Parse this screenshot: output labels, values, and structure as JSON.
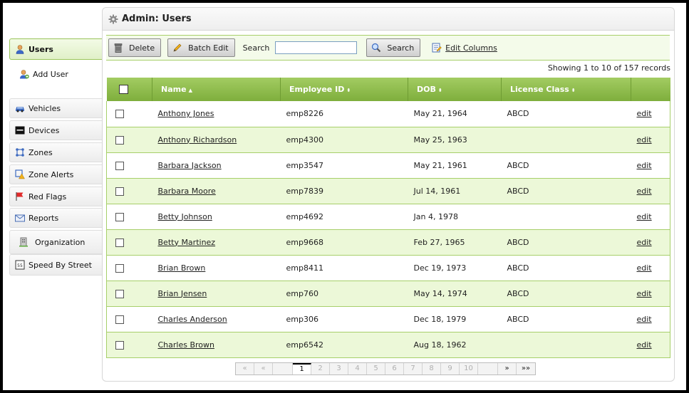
{
  "header": {
    "title": "Admin: Users"
  },
  "sidebar": {
    "items": [
      {
        "label": "Users",
        "icon": "user-icon"
      },
      {
        "label": "Add User",
        "icon": "add-user-icon"
      },
      {
        "label": "Vehicles",
        "icon": "car-icon"
      },
      {
        "label": "Devices",
        "icon": "device-icon"
      },
      {
        "label": "Zones",
        "icon": "zones-icon"
      },
      {
        "label": "Zone Alerts",
        "icon": "zone-alert-icon"
      },
      {
        "label": "Red Flags",
        "icon": "red-flag-icon"
      },
      {
        "label": "Reports",
        "icon": "envelope-icon"
      },
      {
        "label": "Organization",
        "icon": "organization-icon"
      },
      {
        "label": "Speed By Street",
        "icon": "speed-sign-icon"
      }
    ]
  },
  "toolbar": {
    "delete_label": "Delete",
    "batch_edit_label": "Batch Edit",
    "search_label": "Search",
    "search_value": "",
    "search_button_label": "Search",
    "edit_columns_label": "Edit Columns"
  },
  "status": {
    "showing": "Showing 1 to 10 of 157 records"
  },
  "table": {
    "columns": [
      "Name",
      "Employee ID",
      "DOB",
      "License Class"
    ],
    "rows": [
      {
        "name": "Anthony Jones",
        "employee_id": "emp8226",
        "dob": "May 21, 1964",
        "license": "ABCD",
        "edit": "edit"
      },
      {
        "name": "Anthony Richardson",
        "employee_id": "emp4300",
        "dob": "May 25, 1963",
        "license": "",
        "edit": "edit"
      },
      {
        "name": "Barbara Jackson",
        "employee_id": "emp3547",
        "dob": "May 21, 1961",
        "license": "ABCD",
        "edit": "edit"
      },
      {
        "name": "Barbara Moore",
        "employee_id": "emp7839",
        "dob": "Jul 14, 1961",
        "license": "ABCD",
        "edit": "edit"
      },
      {
        "name": "Betty Johnson",
        "employee_id": "emp4692",
        "dob": "Jan 4, 1978",
        "license": "",
        "edit": "edit"
      },
      {
        "name": "Betty Martinez",
        "employee_id": "emp9668",
        "dob": "Feb 27, 1965",
        "license": "ABCD",
        "edit": "edit"
      },
      {
        "name": "Brian Brown",
        "employee_id": "emp8411",
        "dob": "Dec 19, 1973",
        "license": "ABCD",
        "edit": "edit"
      },
      {
        "name": "Brian Jensen",
        "employee_id": "emp760",
        "dob": "May 14, 1974",
        "license": "ABCD",
        "edit": "edit"
      },
      {
        "name": "Charles Anderson",
        "employee_id": "emp306",
        "dob": "Dec 18, 1979",
        "license": "ABCD",
        "edit": "edit"
      },
      {
        "name": "Charles Brown",
        "employee_id": "emp6542",
        "dob": "Aug 18, 1962",
        "license": "",
        "edit": "edit"
      }
    ]
  },
  "pager": {
    "first": "«",
    "prev": "«",
    "pages": [
      "1",
      "2",
      "3",
      "4",
      "5",
      "6",
      "7",
      "8",
      "9",
      "10"
    ],
    "current": "1",
    "next": "»",
    "last": "»»"
  },
  "colors": {
    "accent_green": "#8bb84a",
    "row_alt": "#ecf8d8"
  }
}
